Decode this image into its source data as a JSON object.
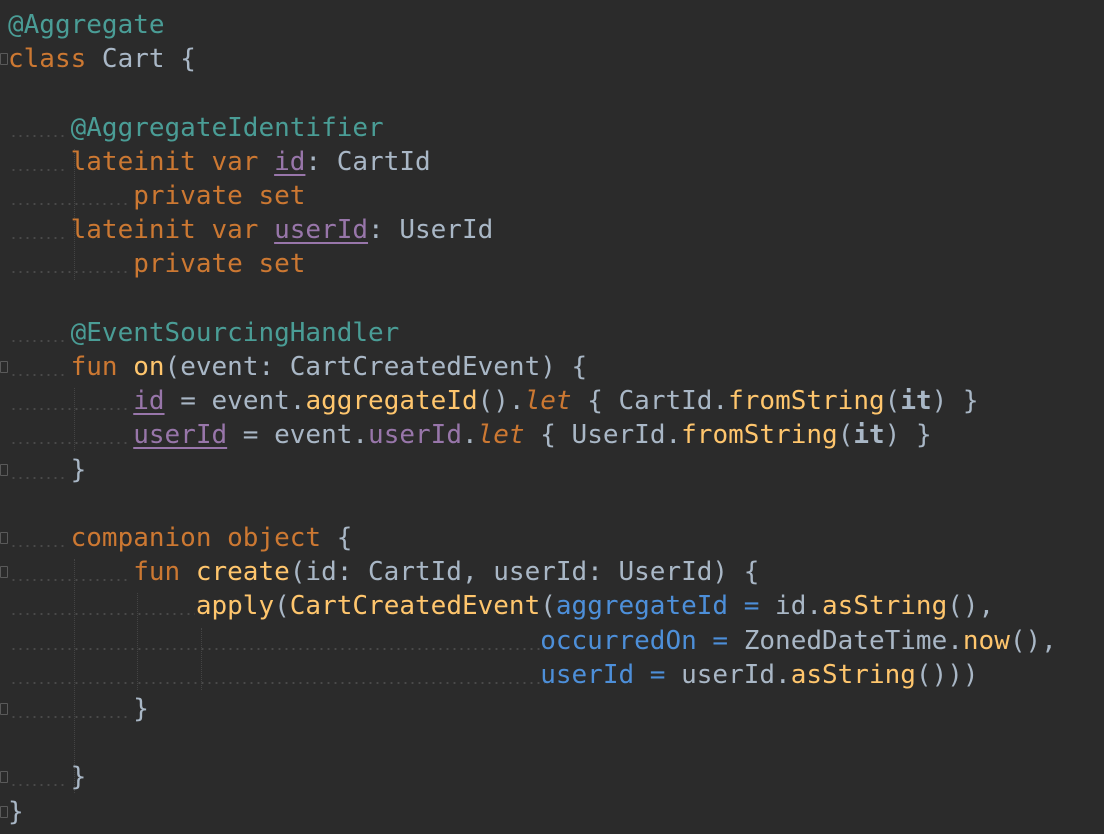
{
  "code_lines": [
    [
      {
        "t": "@Aggregate",
        "c": "ann"
      }
    ],
    [
      {
        "t": "class",
        "c": "kw"
      },
      {
        "t": " Cart {",
        "c": "plain"
      }
    ],
    [],
    [
      {
        "t": "    @AggregateIdentifier",
        "c": "ann"
      }
    ],
    [
      {
        "t": "    lateinit var ",
        "c": "kw"
      },
      {
        "t": "id",
        "c": "prop-u"
      },
      {
        "t": ": CartId",
        "c": "plain"
      }
    ],
    [
      {
        "t": "        private set",
        "c": "kw"
      }
    ],
    [
      {
        "t": "    lateinit var ",
        "c": "kw"
      },
      {
        "t": "userId",
        "c": "prop-u"
      },
      {
        "t": ": UserId",
        "c": "plain"
      }
    ],
    [
      {
        "t": "        private set",
        "c": "kw"
      }
    ],
    [],
    [
      {
        "t": "    @EventSourcingHandler",
        "c": "ann"
      }
    ],
    [
      {
        "t": "    fun ",
        "c": "kw"
      },
      {
        "t": "on",
        "c": "fn"
      },
      {
        "t": "(event: CartCreatedEvent) {",
        "c": "plain"
      }
    ],
    [
      {
        "t": "        ",
        "c": "plain"
      },
      {
        "t": "id",
        "c": "prop-u"
      },
      {
        "t": " = event.",
        "c": "plain"
      },
      {
        "t": "aggregateId",
        "c": "call"
      },
      {
        "t": "().",
        "c": "plain"
      },
      {
        "t": "let",
        "c": "ital"
      },
      {
        "t": " { CartId.",
        "c": "plain"
      },
      {
        "t": "fromString",
        "c": "call"
      },
      {
        "t": "(",
        "c": "plain"
      },
      {
        "t": "it",
        "c": "bold"
      },
      {
        "t": ") }",
        "c": "plain"
      }
    ],
    [
      {
        "t": "        ",
        "c": "plain"
      },
      {
        "t": "userId",
        "c": "prop-u"
      },
      {
        "t": " = event.",
        "c": "plain"
      },
      {
        "t": "userId",
        "c": "prop"
      },
      {
        "t": ".",
        "c": "plain"
      },
      {
        "t": "let",
        "c": "ital"
      },
      {
        "t": " { UserId.",
        "c": "plain"
      },
      {
        "t": "fromString",
        "c": "call"
      },
      {
        "t": "(",
        "c": "plain"
      },
      {
        "t": "it",
        "c": "bold"
      },
      {
        "t": ") }",
        "c": "plain"
      }
    ],
    [
      {
        "t": "    }",
        "c": "plain"
      }
    ],
    [],
    [
      {
        "t": "    companion object",
        "c": "kw"
      },
      {
        "t": " {",
        "c": "plain"
      }
    ],
    [
      {
        "t": "        fun ",
        "c": "kw"
      },
      {
        "t": "create",
        "c": "fn"
      },
      {
        "t": "(id: CartId, userId: UserId) {",
        "c": "plain"
      }
    ],
    [
      {
        "t": "            ",
        "c": "plain"
      },
      {
        "t": "apply",
        "c": "call"
      },
      {
        "t": "(",
        "c": "plain"
      },
      {
        "t": "CartCreatedEvent",
        "c": "call"
      },
      {
        "t": "(",
        "c": "plain"
      },
      {
        "t": "aggregateId",
        "c": "named"
      },
      {
        "t": " = ",
        "c": "named"
      },
      {
        "t": "id.",
        "c": "plain"
      },
      {
        "t": "asString",
        "c": "call"
      },
      {
        "t": "(),",
        "c": "plain"
      }
    ],
    [
      {
        "t": "                                  ",
        "c": "plain"
      },
      {
        "t": "occurredOn",
        "c": "named"
      },
      {
        "t": " = ",
        "c": "named"
      },
      {
        "t": "ZonedDateTime.",
        "c": "plain"
      },
      {
        "t": "now",
        "c": "call"
      },
      {
        "t": "(),",
        "c": "plain"
      }
    ],
    [
      {
        "t": "                                  ",
        "c": "plain"
      },
      {
        "t": "userId",
        "c": "named"
      },
      {
        "t": " = ",
        "c": "named"
      },
      {
        "t": "userId.",
        "c": "plain"
      },
      {
        "t": "asString",
        "c": "call"
      },
      {
        "t": "()))",
        "c": "plain"
      }
    ],
    [
      {
        "t": "        }",
        "c": "plain"
      }
    ],
    [],
    [
      {
        "t": "    }",
        "c": "plain"
      }
    ],
    [
      {
        "t": "}",
        "c": "plain"
      }
    ]
  ],
  "colors": {
    "background": "#2b2b2b",
    "keyword": "#cc7832",
    "annotation": "#4a9d96",
    "property": "#9876aa",
    "function": "#ffc66d",
    "named_argument": "#4d8fd9",
    "plain": "#a9b7c6"
  }
}
